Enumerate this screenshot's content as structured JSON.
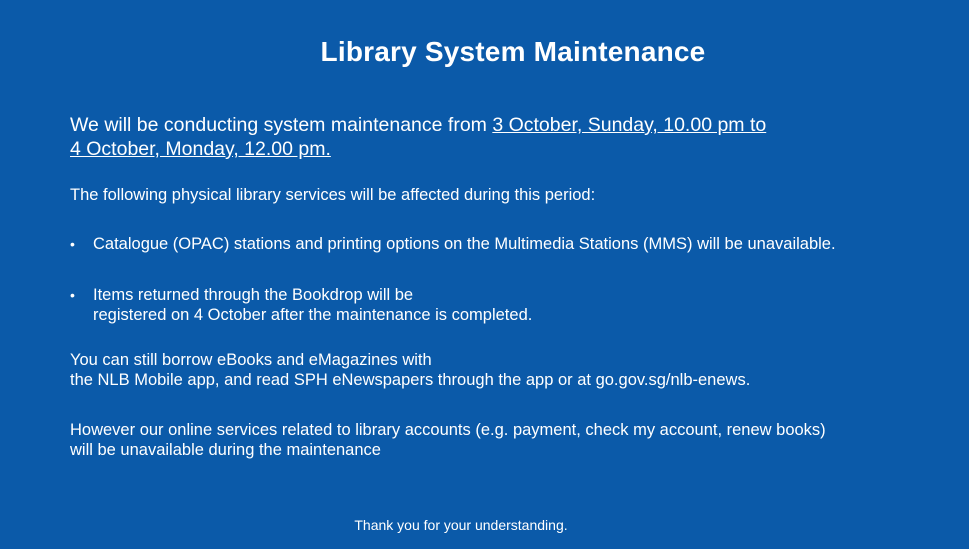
{
  "notice": {
    "title": "Library System Maintenance",
    "intro_prefix": "We will be conducting system maintenance from ",
    "intro_period_line1": "3 October, Sunday, 10.00 pm to",
    "intro_period_line2": "4 October, Monday, 12.00 pm.",
    "affected_heading": "The following physical library services will be affected during this period:",
    "bullets": [
      {
        "line1": "Catalogue (OPAC) stations and printing options on the Multimedia Stations  (MMS) will be unavailable."
      },
      {
        "line1": "Items returned through the Bookdrop will be",
        "line2": "registered on 4 October after the maintenance is completed."
      }
    ],
    "borrow_line1": "You can still borrow eBooks and eMagazines with",
    "borrow_line2": "the NLB Mobile app, and read SPH eNewspapers through the app or at go.gov.sg/nlb-enews.",
    "online_line1": "However our online services related to library accounts (e.g. payment, check my account, renew books)",
    "online_line2": "will be unavailable during the maintenance",
    "thanks": "Thank you for your understanding."
  },
  "colors": {
    "background": "#0b5aa9",
    "text": "#ffffff"
  }
}
